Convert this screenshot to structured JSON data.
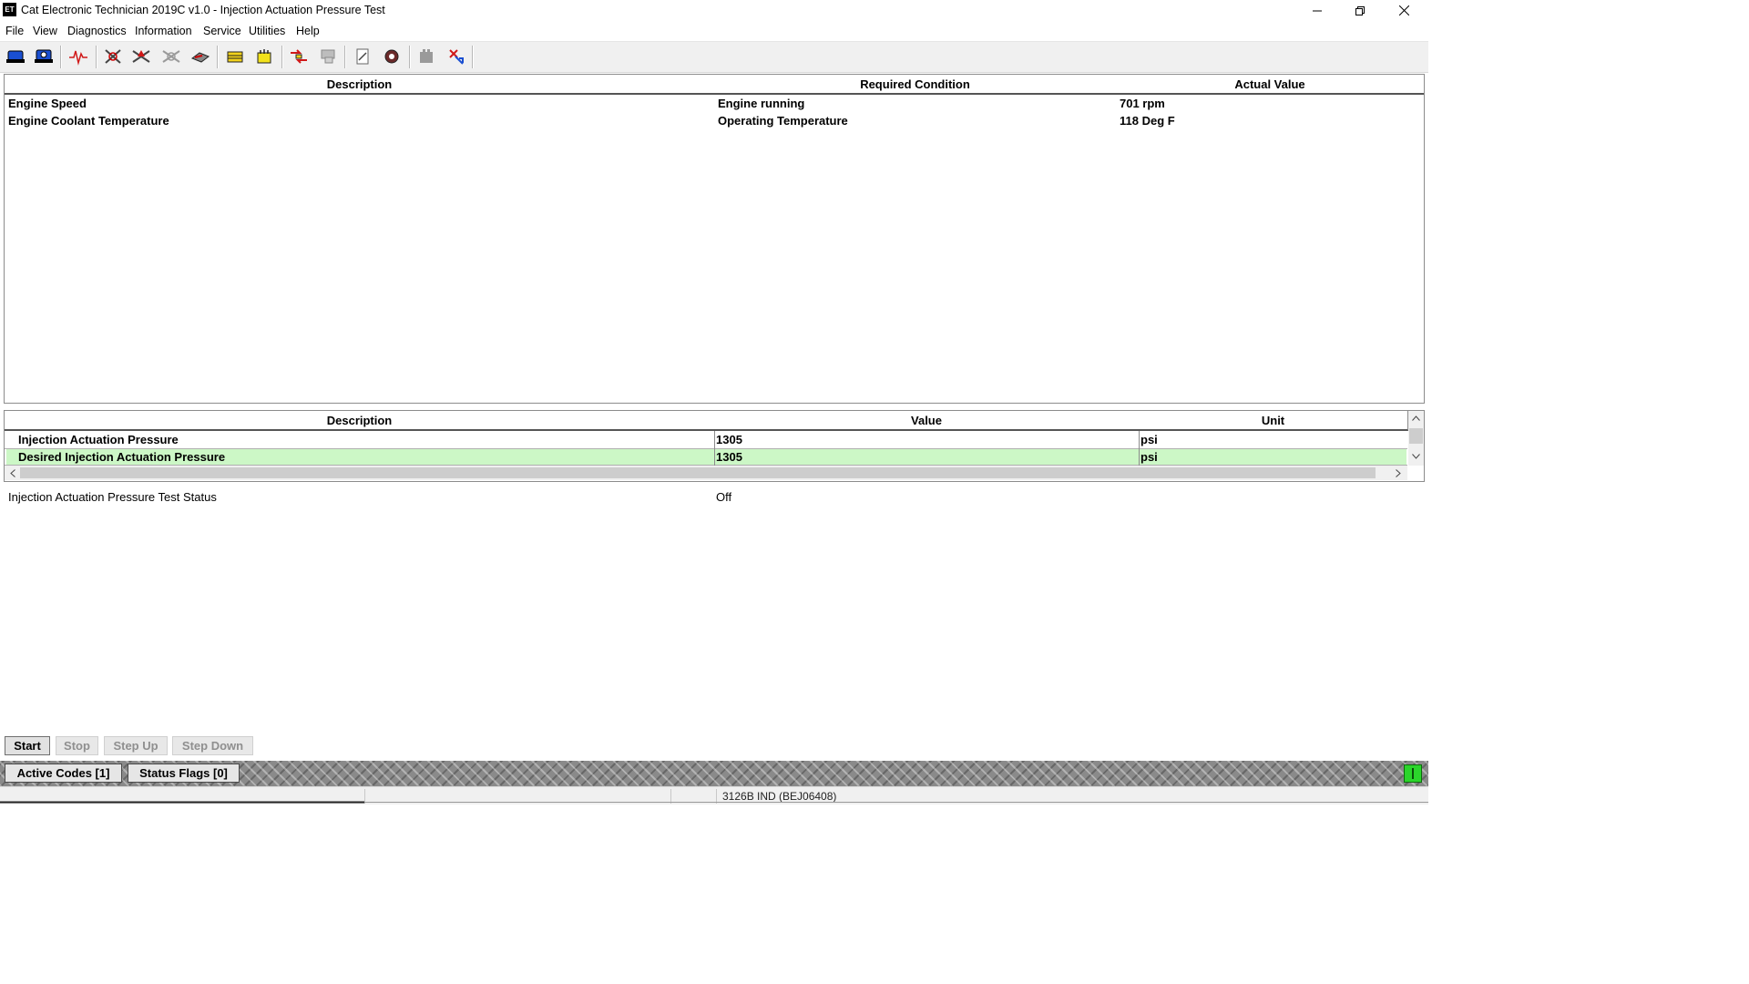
{
  "window": {
    "title": "Cat Electronic Technician 2019C v1.0 - Injection Actuation Pressure Test",
    "logo_text": "ET",
    "minimize_icon": "minimize-icon",
    "maximize_icon": "restore-icon",
    "close_icon": "close-icon"
  },
  "menu": [
    "File",
    "View",
    "Diagnostics",
    "Information",
    "Service",
    "Utilities",
    "Help"
  ],
  "toolbar": {
    "icons": [
      "connect-icon",
      "ecm-summary-icon",
      "status-graph-icon",
      "diagnostic-codes-icon",
      "event-codes-icon",
      "clear-codes-icon",
      "logged-events-icon",
      "configuration-icon",
      "calibrations-icon",
      "data-link-icon",
      "disabled-print-icon",
      "notepad-icon",
      "service-tool-icon",
      "disabled-wrench-icon",
      "flash-icon"
    ]
  },
  "conditions_table": {
    "columns": [
      "Description",
      "Required Condition",
      "Actual Value"
    ],
    "rows": [
      [
        "Engine Speed",
        "Engine running",
        "701 rpm"
      ],
      [
        "Engine Coolant Temperature",
        "Operating Temperature",
        "118 Deg F"
      ]
    ]
  },
  "parameters_table": {
    "columns": [
      "Description",
      "Value",
      "Unit"
    ],
    "rows": [
      [
        "Injection Actuation Pressure",
        "1305",
        "psi"
      ],
      [
        "Desired Injection Actuation Pressure",
        "1305",
        "psi"
      ]
    ],
    "highlight_color": "#ccf7c6"
  },
  "test_status": {
    "label": "Injection Actuation Pressure Test Status",
    "value": "Off"
  },
  "buttons": {
    "start": "Start",
    "stop": "Stop",
    "step_up": "Step Up",
    "step_down": "Step Down"
  },
  "tabs": {
    "active_codes": "Active Codes [1]",
    "status_flags": "Status Flags [0]"
  },
  "status_bar": {
    "ecm": "3126B IND (BEJ06408)",
    "indicator_color": "#2bd52b"
  }
}
